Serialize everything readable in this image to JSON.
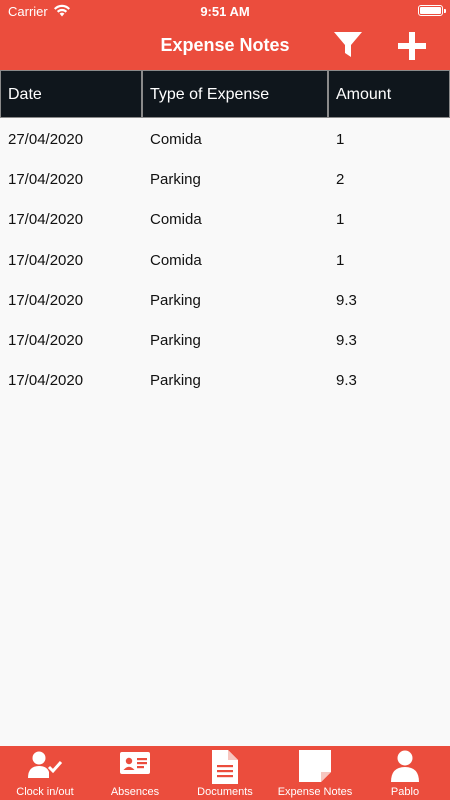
{
  "status_bar": {
    "carrier": "Carrier",
    "time": "9:51 AM"
  },
  "nav": {
    "title": "Expense Notes",
    "filter_icon": "filter-icon",
    "add_icon": "plus-icon"
  },
  "table": {
    "headers": [
      "Date",
      "Type of Expense",
      "Amount"
    ],
    "rows": [
      [
        "27/04/2020",
        "Comida",
        "1"
      ],
      [
        "17/04/2020",
        "Parking",
        "2"
      ],
      [
        "17/04/2020",
        "Comida",
        "1"
      ],
      [
        "17/04/2020",
        "Comida",
        "1"
      ],
      [
        "17/04/2020",
        "Parking",
        "9.3"
      ],
      [
        "17/04/2020",
        "Parking",
        "9.3"
      ],
      [
        "17/04/2020",
        "Parking",
        "9.3"
      ]
    ]
  },
  "tabs": [
    {
      "label": "Clock in/out",
      "icon": "clock-in-user-check-icon"
    },
    {
      "label": "Absences",
      "icon": "id-card-icon"
    },
    {
      "label": "Documents",
      "icon": "document-icon"
    },
    {
      "label": "Expense Notes",
      "icon": "note-icon"
    },
    {
      "label": "Pablo",
      "icon": "user-icon"
    }
  ],
  "colors": {
    "accent": "#eb4d3d",
    "header_dark": "#0f161c",
    "background": "#f9f9f9"
  }
}
